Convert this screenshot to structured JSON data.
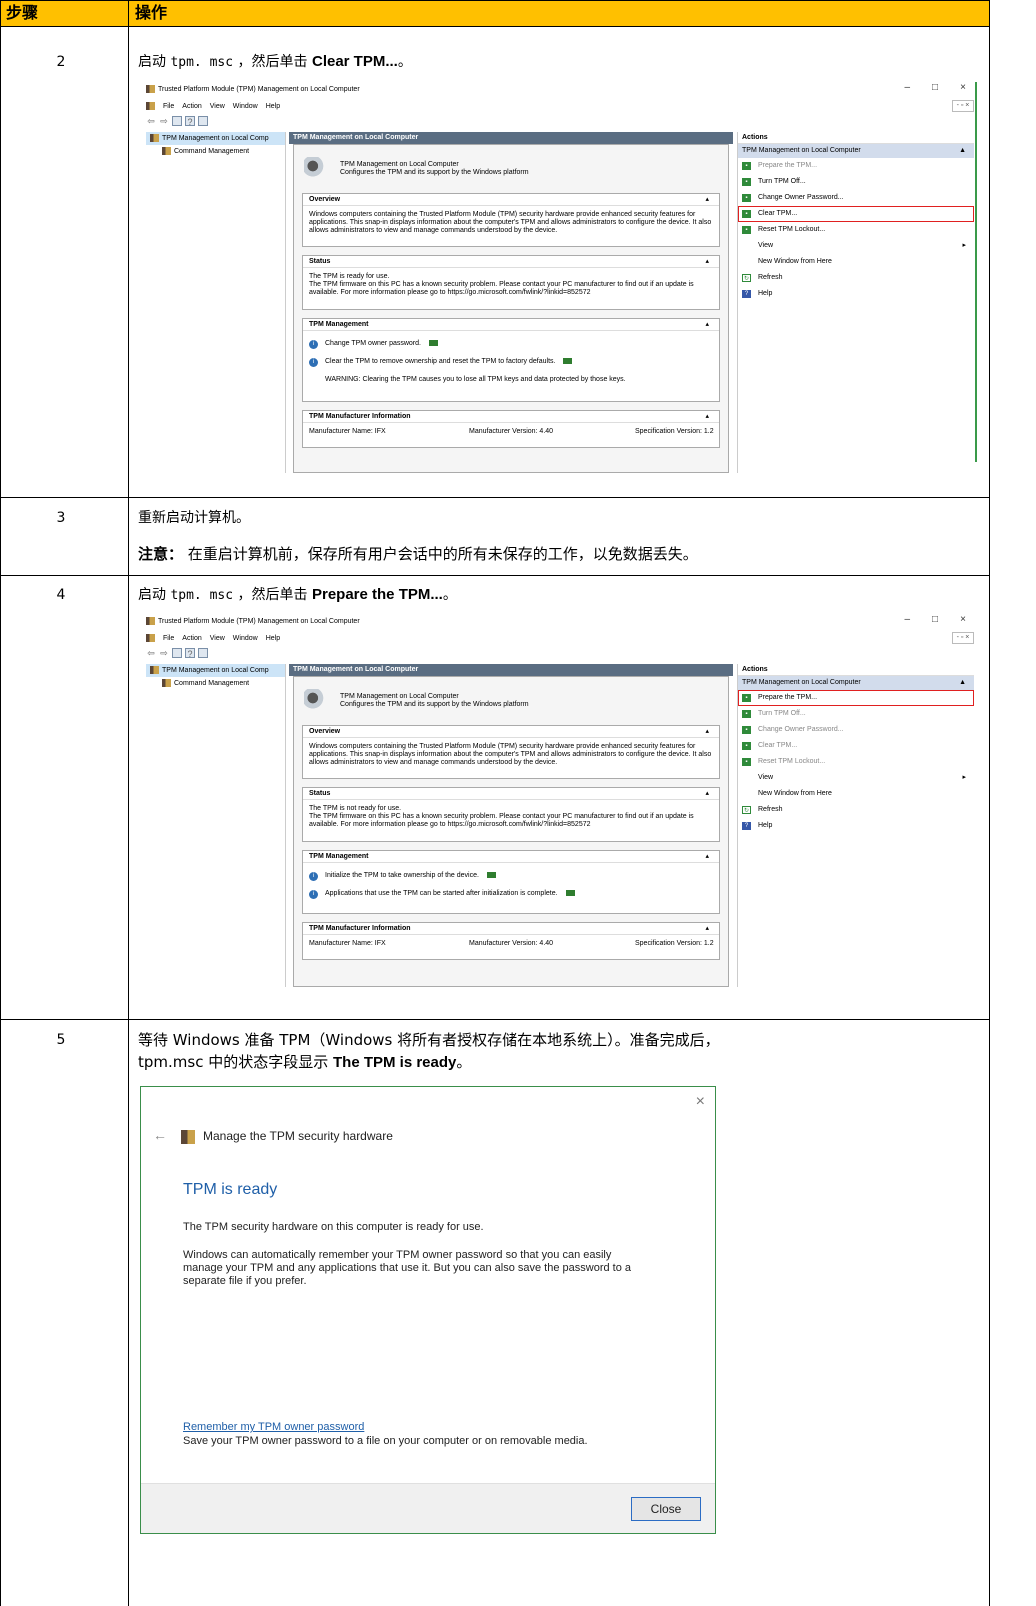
{
  "header": {
    "col1": "步骤",
    "col2": "操作"
  },
  "steps": {
    "s2": {
      "num": "2",
      "pre": "启动 ",
      "cmd": "tpm. msc",
      "mid": " ，然后单击 ",
      "bold": "Clear TPM...",
      "post": "。"
    },
    "s3": {
      "num": "3",
      "line1": "重新启动计算机。",
      "note_label": "注意：",
      "note_text": "在重启计算机前，保存所有用户会话中的所有未保存的工作，以免数据丢失。"
    },
    "s4": {
      "num": "4",
      "pre": "启动 ",
      "cmd": "tpm. msc",
      "mid": " ，然后单击 ",
      "bold": "Prepare the TPM...",
      "post": "。"
    },
    "s5": {
      "num": "5",
      "line1": "等待 Windows 准备 TPM（Windows 将所有者授权存储在本地系统上）。准备完成后，",
      "line2_pre": "tpm.msc 中的状态字段显示 ",
      "line2_bold": "The TPM is ready",
      "line2_post": "。"
    }
  },
  "mmc1": {
    "title": "Trusted Platform Module (TPM) Management on Local Computer",
    "menu": [
      "File",
      "Action",
      "View",
      "Window",
      "Help"
    ],
    "tree": [
      "TPM Management on Local Comp",
      "Command Management"
    ],
    "center_header": "TPM Management on Local Computer",
    "intro_l1": "TPM Management on Local Computer",
    "intro_l2": "Configures the TPM and its support by the Windows platform",
    "overview_h": "Overview",
    "overview_b": "Windows computers containing the Trusted Platform Module (TPM) security hardware provide enhanced security features for\napplications. This snap-in displays information about the computer's TPM and allows administrators to configure the device. It also\nallows administrators to view and manage commands understood by the device.",
    "status_h": "Status",
    "status_b": "The TPM is ready for use.\nThe TPM firmware on this PC has a known security problem. Please contact your PC manufacturer to find out if an update is\navailable. For more information please go to https://go.microsoft.com/fwlink/?linkid=852572",
    "mgmt_h": "TPM Management",
    "mgmt_r1": "Change TPM owner password.",
    "mgmt_r2": "Clear the TPM to remove ownership and reset the TPM to factory defaults.",
    "mgmt_warn": "WARNING: Clearing the TPM causes you to lose all TPM keys and data protected by those keys.",
    "mfr_h": "TPM Manufacturer Information",
    "mfr_name": "Manufacturer Name:  IFX",
    "mfr_ver": "Manufacturer Version:  4.40",
    "spec_ver": "Specification Version:  1.2",
    "actions_h": "Actions",
    "actions_grp": "TPM Management on Local Computer",
    "actions": [
      "Prepare the TPM...",
      "Turn TPM Off...",
      "Change Owner Password...",
      "Clear TPM...",
      "Reset TPM Lockout...",
      "View",
      "New Window from Here",
      "Refresh",
      "Help"
    ]
  },
  "mmc2": {
    "title": "Trusted Platform Module (TPM) Management on Local Computer",
    "menu": [
      "File",
      "Action",
      "View",
      "Window",
      "Help"
    ],
    "tree": [
      "TPM Management on Local Comp",
      "Command Management"
    ],
    "center_header": "TPM Management on Local Computer",
    "intro_l1": "TPM Management on Local Computer",
    "intro_l2": "Configures the TPM and its support by the Windows platform",
    "overview_h": "Overview",
    "overview_b": "Windows computers containing the Trusted Platform Module (TPM) security hardware provide enhanced security features for\napplications. This snap-in displays information about the computer's TPM and allows administrators to configure the device. It also\nallows administrators to view and manage commands understood by the device.",
    "status_h": "Status",
    "status_b": "The TPM is not ready for use.\nThe TPM firmware on this PC has a known security problem. Please contact your PC manufacturer to find out if an update is\navailable. For more information please go to https://go.microsoft.com/fwlink/?linkid=852572",
    "mgmt_h": "TPM Management",
    "mgmt_r1": "Initialize the TPM to take ownership of the device.",
    "mgmt_r2": "Applications that use the TPM can be started after initialization is complete.",
    "mfr_h": "TPM Manufacturer Information",
    "mfr_name": "Manufacturer Name:  IFX",
    "mfr_ver": "Manufacturer Version:  4.40",
    "spec_ver": "Specification Version:  1.2",
    "actions_h": "Actions",
    "actions_grp": "TPM Management on Local Computer",
    "actions": [
      "Prepare the TPM...",
      "Turn TPM Off...",
      "Change Owner Password...",
      "Clear TPM...",
      "Reset TPM Lockout...",
      "View",
      "New Window from Here",
      "Refresh",
      "Help"
    ]
  },
  "dialog": {
    "title": "Manage the TPM security hardware",
    "heading": "TPM is ready",
    "p1": "The TPM security hardware on this computer is ready for use.",
    "p2": "Windows can automatically remember your TPM owner password so that you can easily\nmanage your TPM and any applications that use it. But you can also save the password to a\nseparate file if you prefer.",
    "link": "Remember my TPM owner password",
    "link_desc": "Save your TPM owner password to a file on your computer or on removable media.",
    "close": "Close"
  },
  "colors": {
    "header_bg": "#ffc000",
    "highlight": "#e02020",
    "dialog_accent": "#1f5fa8"
  }
}
